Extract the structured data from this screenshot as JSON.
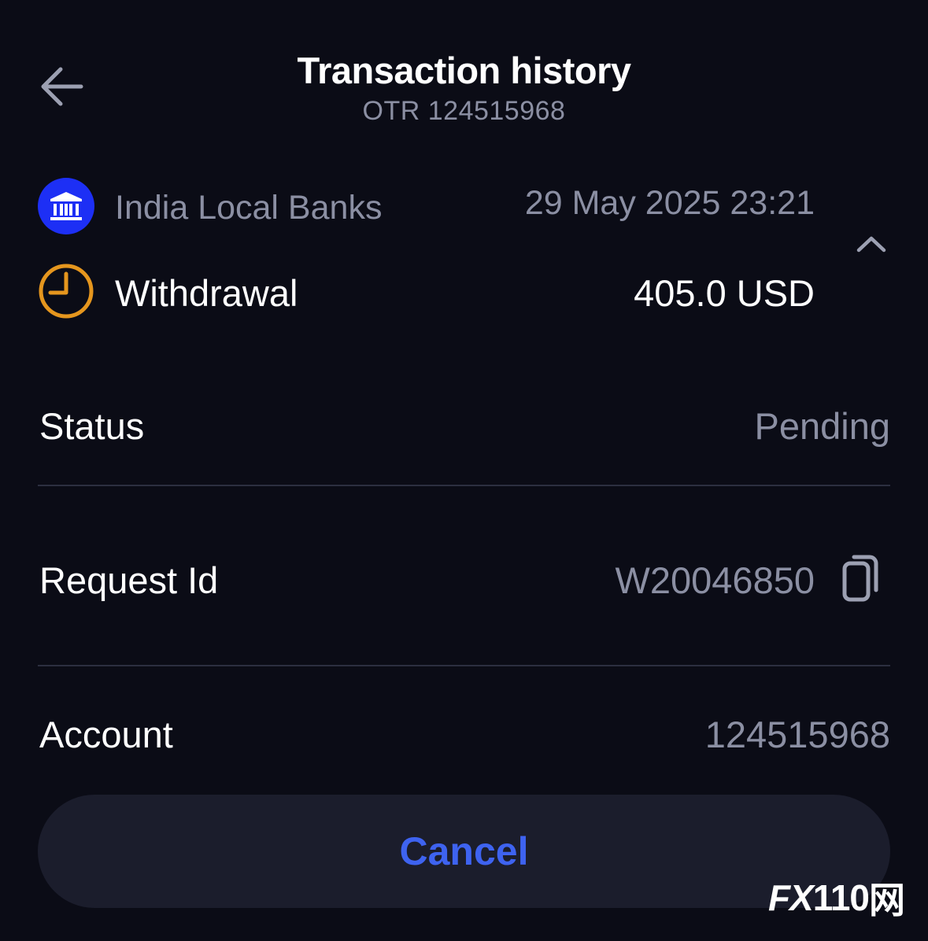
{
  "header": {
    "title": "Transaction history",
    "subtitle": "OTR 124515968"
  },
  "transaction": {
    "method": "India Local Banks",
    "date": "29 May 2025 23:21",
    "type": "Withdrawal",
    "amount": "405.0 USD"
  },
  "details": {
    "status_label": "Status",
    "status_value": "Pending",
    "request_label": "Request Id",
    "request_value": "W20046850",
    "account_label": "Account",
    "account_value": "124515968"
  },
  "actions": {
    "cancel_label": "Cancel"
  },
  "watermark": {
    "fx": "FX",
    "num": "110",
    "cn": "网"
  },
  "colors": {
    "background": "#0b0c16",
    "muted_text": "#8b8fa3",
    "bank_icon_bg": "#1d2ff5",
    "pending_clock": "#e5961e",
    "cancel_text": "#3e63f0",
    "button_bg": "#1b1d2c"
  }
}
